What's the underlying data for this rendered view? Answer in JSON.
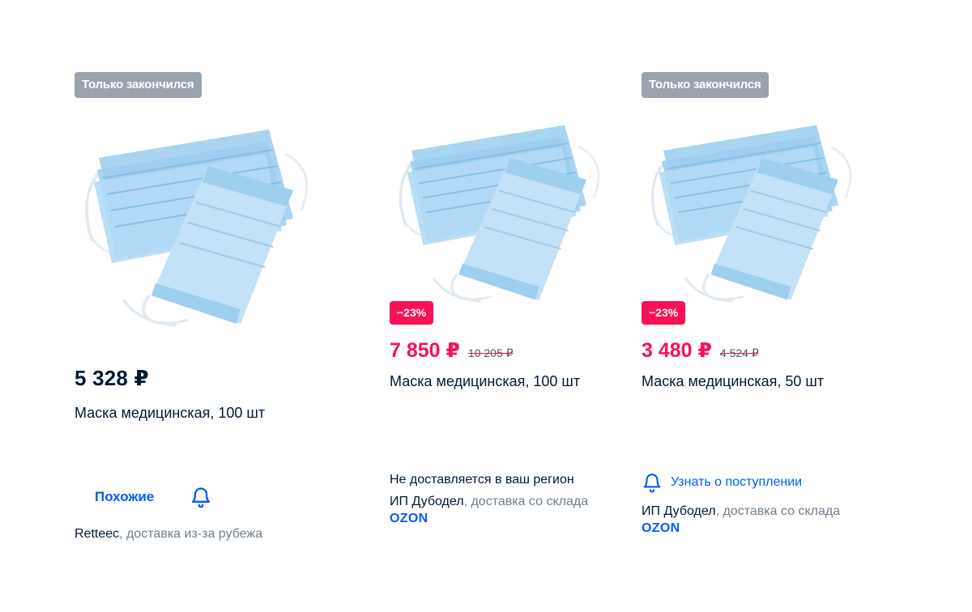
{
  "colors": {
    "accent": "#005bff",
    "discount": "#f91155",
    "badge_gray": "#99a3ae",
    "text_main": "#001a34",
    "text_muted": "#707f8d"
  },
  "products": [
    {
      "stock_badge": "Только закончился",
      "image_icon": "medical-mask-image",
      "price": "5 328 ₽",
      "title": "Маска медицинская, 100 шт",
      "similar_label": "Похожие",
      "bell_icon": "bell-icon",
      "seller_name": "Retteec",
      "seller_delivery": ", доставка из-за рубежа"
    },
    {
      "image_icon": "medical-mask-image",
      "discount": "−23%",
      "price": "7 850 ₽",
      "old_price": "10 205 ₽",
      "title": "Маска медицинская, 100 шт",
      "delivery_note": "Не доставляется в ваш регион",
      "seller_name": "ИП Дубодел",
      "seller_delivery": ", доставка со склада",
      "warehouse": "OZON"
    },
    {
      "stock_badge": "Только закончился",
      "image_icon": "medical-mask-image",
      "discount": "−23%",
      "price": "3 480 ₽",
      "old_price": "4 524 ₽",
      "title": "Маска медицинская, 50 шт",
      "notify_label": "Узнать о поступлении",
      "bell_icon": "bell-icon",
      "seller_name": "ИП Дубодел",
      "seller_delivery": ", доставка со склада",
      "warehouse": "OZON"
    }
  ]
}
